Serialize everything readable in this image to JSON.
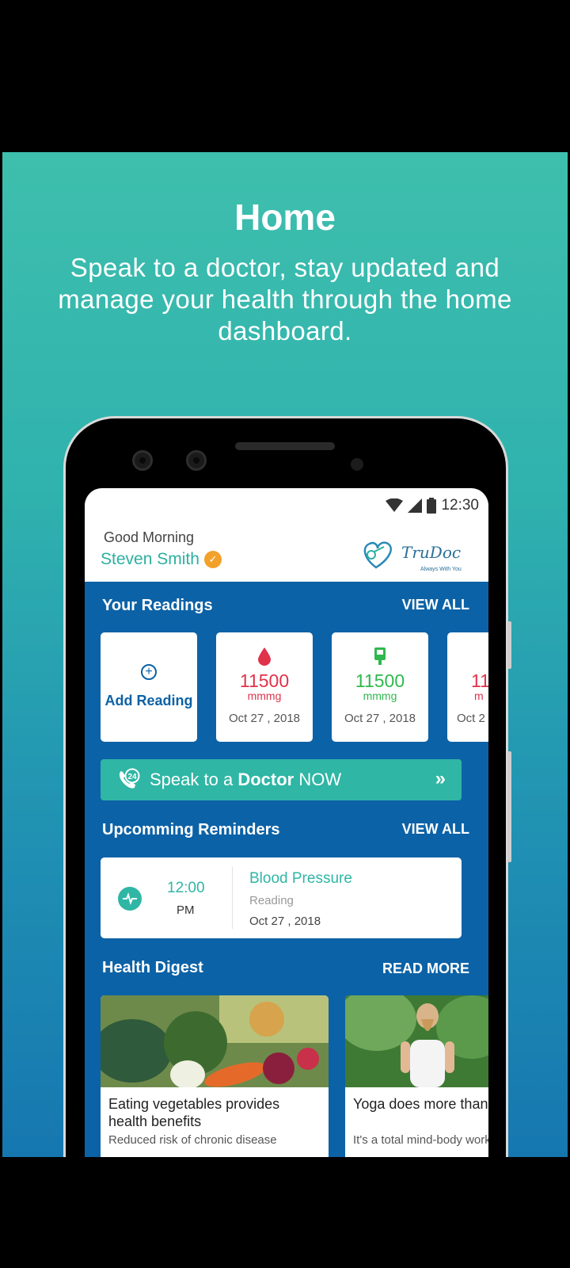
{
  "promo": {
    "title": "Home",
    "subtitle": "Speak to a doctor, stay updated and manage your health through the home dashboard."
  },
  "status_bar": {
    "time": "12:30"
  },
  "header": {
    "greeting": "Good Morning",
    "user_name": "Steven Smith",
    "logo_text": "TruDoc",
    "logo_tagline": "Always With You"
  },
  "readings": {
    "title": "Your Readings",
    "view_all": "VIEW ALL",
    "add_label": "Add Reading",
    "items": [
      {
        "value": "11500",
        "unit": "mmmg",
        "date": "Oct 27 , 2018",
        "color": "#e0324b",
        "icon": "blood-drop-icon"
      },
      {
        "value": "11500",
        "unit": "mmmg",
        "date": "Oct 27 , 2018",
        "color": "#2fb84e",
        "icon": "glucometer-icon"
      },
      {
        "value": "11",
        "unit": "m",
        "date": "Oct 2",
        "color": "#e0324b",
        "icon": "reading-icon"
      }
    ]
  },
  "speak_button": {
    "prefix": "Speak to a ",
    "bold": "Doctor",
    "suffix": " NOW",
    "arrow": "»",
    "badge": "24"
  },
  "reminders": {
    "title": "Upcomming Reminders",
    "view_all": "VIEW ALL",
    "item": {
      "time": "12:00",
      "ampm": "PM",
      "title": "Blood Pressure",
      "type": "Reading",
      "date": "Oct 27 , 2018"
    }
  },
  "digest": {
    "title": "Health Digest",
    "read_more": "READ MORE",
    "items": [
      {
        "title": "Eating vegetables provides health benefits",
        "snippet": "Reduced risk of chronic disease"
      },
      {
        "title": "Yoga does more than burn calories",
        "snippet": "It's a total mind-body workout"
      }
    ]
  },
  "colors": {
    "teal": "#2fb6a5",
    "blue": "#0c62a6",
    "red": "#e0324b",
    "green": "#2fb84e",
    "badge": "#f2a12a"
  }
}
